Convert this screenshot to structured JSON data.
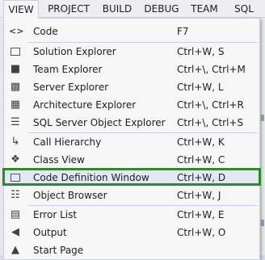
{
  "menubar": {
    "items": [
      "VIEW",
      "PROJECT",
      "BUILD",
      "DEBUG",
      "TEAM",
      "SQL"
    ]
  },
  "menu": {
    "items": [
      {
        "label": "Code",
        "shortcut": "F7",
        "icon": "code-icon"
      },
      {
        "label": "Solution Explorer",
        "shortcut": "Ctrl+W, S",
        "icon": "solution-explorer-icon"
      },
      {
        "label": "Team Explorer",
        "shortcut": "Ctrl+\\, Ctrl+M",
        "icon": "team-explorer-icon"
      },
      {
        "label": "Server Explorer",
        "shortcut": "Ctrl+W, L",
        "icon": "server-explorer-icon"
      },
      {
        "label": "Architecture Explorer",
        "shortcut": "Ctrl+\\, Ctrl+R",
        "icon": "architecture-explorer-icon"
      },
      {
        "label": "SQL Server Object Explorer",
        "shortcut": "Ctrl+\\, Ctrl+S",
        "icon": "sql-server-object-explorer-icon"
      },
      {
        "label": "Call Hierarchy",
        "shortcut": "Ctrl+W, K",
        "icon": "call-hierarchy-icon"
      },
      {
        "label": "Class View",
        "shortcut": "Ctrl+W, C",
        "icon": "class-view-icon"
      },
      {
        "label": "Code Definition Window",
        "shortcut": "Ctrl+W, D",
        "icon": "code-definition-window-icon"
      },
      {
        "label": "Object Browser",
        "shortcut": "Ctrl+W, J",
        "icon": "object-browser-icon"
      },
      {
        "label": "Error List",
        "shortcut": "Ctrl+W, E",
        "icon": "error-list-icon"
      },
      {
        "label": "Output",
        "shortcut": "Ctrl+W, O",
        "icon": "output-icon"
      },
      {
        "label": "Start Page",
        "shortcut": "",
        "icon": "start-page-icon"
      }
    ]
  },
  "colors": {
    "highlight_border": "#2c8a2c",
    "menu_background": "#f6f6f6"
  }
}
